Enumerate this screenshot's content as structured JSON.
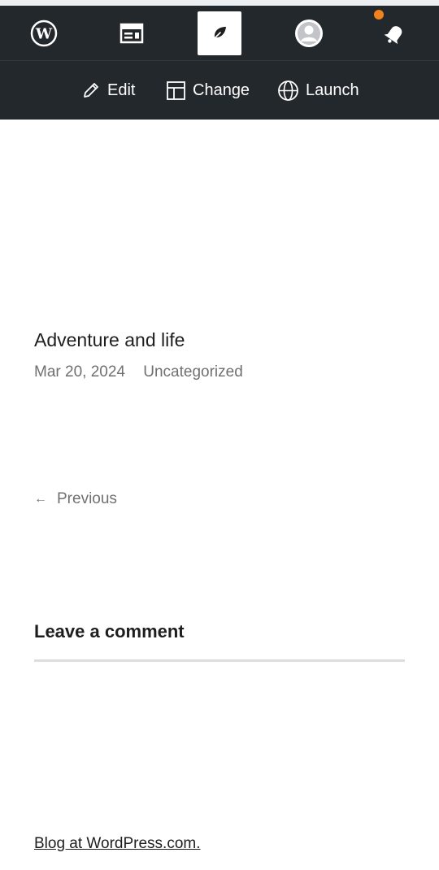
{
  "admin_bar": {
    "icons": [
      "wordpress-icon",
      "reader-icon",
      "site-icon",
      "avatar-icon",
      "notifications-bell-icon"
    ],
    "notification_dot_color": "#f0821e",
    "background": "#23282d",
    "actions": {
      "edit_label": "Edit",
      "change_label": "Change",
      "launch_label": "Launch"
    }
  },
  "post": {
    "title": "Adventure and life",
    "date": "Mar 20, 2024",
    "category": "Uncategorized"
  },
  "navigation": {
    "previous_arrow": "←",
    "previous_label": "Previous"
  },
  "comments": {
    "heading": "Leave a comment"
  },
  "footer": {
    "link_text": "Blog at WordPress.com."
  }
}
